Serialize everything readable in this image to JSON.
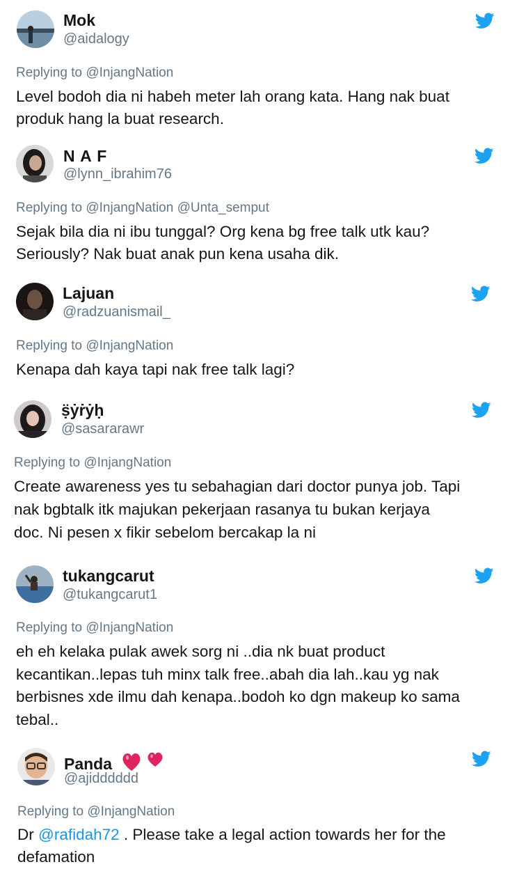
{
  "tweets": [
    {
      "name": "Mok",
      "handle": "@aidalogy",
      "reply": "Replying to @InjangNation",
      "lines": [
        "Level bodoh dia ni habeh meter lah orang kata. Hang nak buat",
        "produk hang la buat research."
      ]
    },
    {
      "name": "N A F",
      "handle": "@lynn_ibrahim76",
      "reply": "Replying to @InjangNation @Unta_semput",
      "lines": [
        "Sejak bila dia ni ibu tunggal? Org kena bg free talk utk kau?",
        "Seriously? Nak buat anak pun kena usaha dik."
      ]
    },
    {
      "name": "Lajuan",
      "handle": "@radzuanismail_",
      "reply": "Replying to @InjangNation",
      "lines": [
        "Kenapa dah kaya tapi nak free talk lagi?"
      ]
    },
    {
      "name": "ṣ̈ẏṙẏḥ",
      "handle": "@sasararawr",
      "reply": "Replying to @InjangNation",
      "lines": [
        "Create awareness yes tu sebahagian dari doctor punya job. Tapi",
        "nak bgbtalk itk majukan pekerjaan rasanya tu bukan kerjaya",
        "doc. Ni pesen x fikir sebelom bercakap la ni"
      ]
    },
    {
      "name": "tukangcarut",
      "handle": "@tukangcarut1",
      "reply": "Replying to @InjangNation",
      "lines": [
        "eh eh kelaka pulak awek sorg ni ..dia nk buat product",
        "kecantikan..lepas tuh minx talk free..abah dia lah..kau yg nak",
        "berbisnes xde ilmu dah kenapa..bodoh ko dgn makeup ko sama",
        "tebal.."
      ]
    },
    {
      "name": "Panda",
      "handle": "@ajidddddd",
      "reply": "Replying to @InjangNation",
      "line1_pre": "Dr ",
      "line1_mention": "@rafidah72",
      "line1_post": " . Please take a legal action towards her for the",
      "line2": "defamation"
    }
  ],
  "colors": {
    "twitter_blue": "#1da1f2",
    "text": "#14171a",
    "secondary": "#657786",
    "mention": "#1b95e0",
    "heart": "#e0245e"
  },
  "icons": [
    "twitter-bird-icon",
    "two-hearts-emoji"
  ]
}
